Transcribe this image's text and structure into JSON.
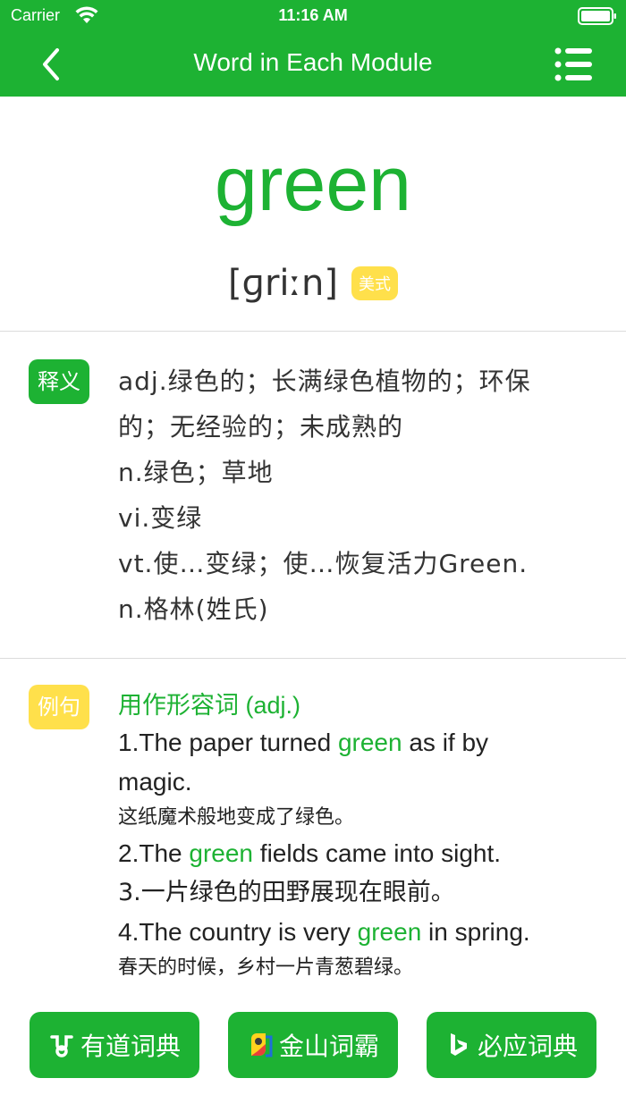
{
  "status_bar": {
    "carrier": "Carrier",
    "time": "11:16 AM"
  },
  "nav": {
    "title": "Word in Each Module",
    "back_icon": "chevron-left-icon",
    "menu_icon": "list-icon"
  },
  "word": {
    "text": "green",
    "phonetic": "[ɡriːn]",
    "accent": "美式"
  },
  "definitions": {
    "tag": "释义",
    "lines": [
      "adj.绿色的；长满绿色植物的；环保",
      "的；无经验的；未成熟的",
      "n.绿色；草地",
      "vi.变绿",
      "vt.使…变绿；使…恢复活力Green.",
      "n.格林(姓氏)"
    ]
  },
  "examples": {
    "tag": "例句",
    "heading": "用作形容词 (adj.)",
    "items": [
      {
        "pre": "1.The paper turned ",
        "hl": "green",
        "post": " as if by",
        "line2": "magic.",
        "zh": "这纸魔术般地变成了绿色。"
      },
      {
        "pre": "2.The ",
        "hl": "green",
        "post": " fields came into sight.",
        "zh": "3.一片绿色的田野展现在眼前。"
      },
      {
        "pre": "4.The country is very ",
        "hl": "green",
        "post": " in spring.",
        "zh": "春天的时候，乡村一片青葱碧绿。"
      }
    ]
  },
  "dictionaries": {
    "youdao": "有道词典",
    "jinshan": "金山词霸",
    "biying": "必应词典"
  },
  "colors": {
    "brand_green": "#1DB233",
    "badge_yellow": "#FFE04B"
  }
}
